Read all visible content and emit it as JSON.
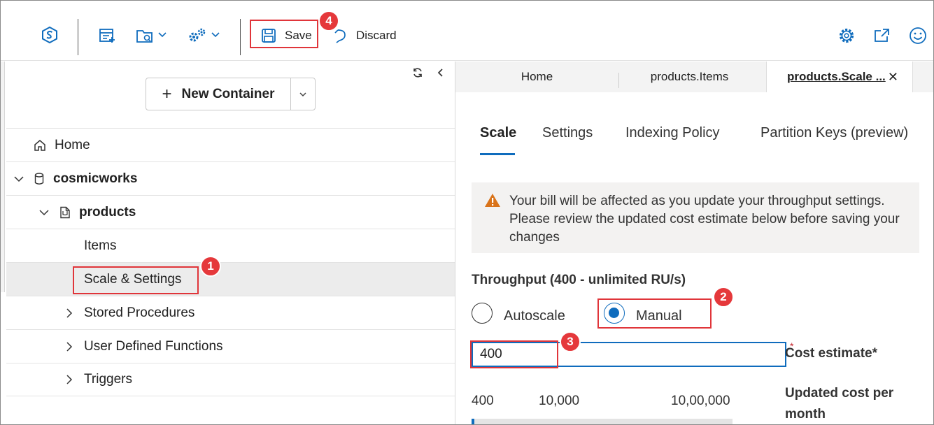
{
  "toolbar": {
    "save_label": "Save",
    "discard_label": "Discard"
  },
  "sidebar": {
    "new_container_label": "New Container",
    "tree": [
      {
        "label": "Home",
        "level": 0,
        "icon": "home-icon"
      },
      {
        "label": "cosmicworks",
        "level": 0,
        "icon": "database-icon",
        "expanded": true
      },
      {
        "label": "products",
        "level": 1,
        "icon": "document-icon",
        "expanded": true
      },
      {
        "label": "Items",
        "level": 2
      },
      {
        "label": "Scale & Settings",
        "level": 2,
        "selected": true
      },
      {
        "label": "Stored Procedures",
        "level": 2,
        "collapsed": true
      },
      {
        "label": "User Defined Functions",
        "level": 2,
        "collapsed": true
      },
      {
        "label": "Triggers",
        "level": 2,
        "collapsed": true
      }
    ]
  },
  "tabs": [
    {
      "label": "Home"
    },
    {
      "label": "products.Items"
    },
    {
      "label": "products.Scale ...",
      "active": true
    }
  ],
  "subtabs": [
    {
      "label": "Scale",
      "active": true
    },
    {
      "label": "Settings"
    },
    {
      "label": "Indexing Policy"
    },
    {
      "label": "Partition Keys (preview)"
    }
  ],
  "warning": {
    "text": "Your bill will be affected as you update your throughput settings. Please review the updated cost estimate below before saving your changes"
  },
  "throughput": {
    "label": "Throughput (400 - unlimited RU/s)",
    "options": [
      "Autoscale",
      "Manual"
    ],
    "selected": "Manual",
    "value": "400",
    "cost_label": "Cost estimate*",
    "cost_asterisk": "*",
    "updated_cost_label": "Updated cost per month",
    "slider_ticks": [
      "400",
      "10,000",
      "10,00,000"
    ],
    "slider_fraction": 0.01
  },
  "annotations": [
    "1",
    "2",
    "3",
    "4"
  ],
  "colors": {
    "accent": "#0f6cbd",
    "annotation_red": "#e5383b",
    "warning_bg": "#f3f2f1",
    "selected_row": "#ececec"
  }
}
